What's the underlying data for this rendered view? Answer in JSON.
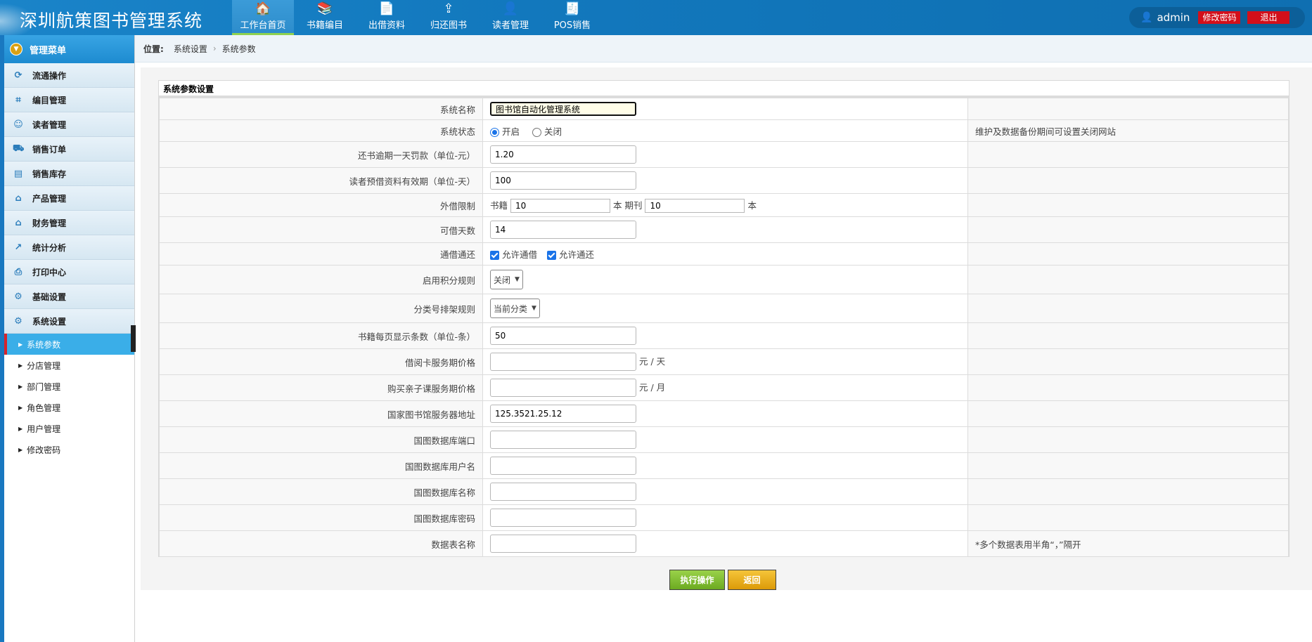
{
  "header": {
    "title": "深圳航策图书管理系统",
    "nav": [
      {
        "label": "工作台首页",
        "icon": "home-icon",
        "glyph": "🏠"
      },
      {
        "label": "书籍编目",
        "icon": "books-icon",
        "glyph": "📚"
      },
      {
        "label": "出借资料",
        "icon": "lend-doc-icon",
        "glyph": "📄"
      },
      {
        "label": "归还图书",
        "icon": "return-upload-icon",
        "glyph": "⇪"
      },
      {
        "label": "读者管理",
        "icon": "reader-icon",
        "glyph": "👤"
      },
      {
        "label": "POS销售",
        "icon": "pos-icon",
        "glyph": "🧾"
      }
    ],
    "user": "admin",
    "change_password": "修改密码",
    "logout": "退出"
  },
  "sidebar": {
    "title": "管理菜单",
    "items": [
      {
        "label": "流通操作",
        "icon": "circulation-icon",
        "glyph": "⟳"
      },
      {
        "label": "编目管理",
        "icon": "catalog-icon",
        "glyph": "⌗"
      },
      {
        "label": "读者管理",
        "icon": "reader-icon",
        "glyph": "☺"
      },
      {
        "label": "销售订单",
        "icon": "cart-icon",
        "glyph": "⛟"
      },
      {
        "label": "销售库存",
        "icon": "inventory-icon",
        "glyph": "▤"
      },
      {
        "label": "产品管理",
        "icon": "product-icon",
        "glyph": "⌂"
      },
      {
        "label": "财务管理",
        "icon": "finance-icon",
        "glyph": "⌂"
      },
      {
        "label": "统计分析",
        "icon": "chart-icon",
        "glyph": "↗"
      },
      {
        "label": "打印中心",
        "icon": "printer-icon",
        "glyph": "⎙"
      },
      {
        "label": "基础设置",
        "icon": "gear-icon",
        "glyph": "⚙"
      },
      {
        "label": "系统设置",
        "icon": "gear-icon",
        "glyph": "⚙"
      }
    ],
    "sub_items": [
      "系统参数",
      "分店管理",
      "部门管理",
      "角色管理",
      "用户管理",
      "修改密码"
    ]
  },
  "breadcrumb": {
    "label": "位置:",
    "path": [
      "系统设置",
      "系统参数"
    ]
  },
  "panel": {
    "title": "系统参数设置",
    "rows": {
      "system_name": {
        "label": "系统名称",
        "value": "图书馆自动化管理系统"
      },
      "system_status": {
        "label": "系统状态",
        "on": "开启",
        "off": "关闭",
        "tip": "维护及数据备份期间可设置关闭网站"
      },
      "overdue_fine": {
        "label": "还书逾期一天罚款（单位-元）",
        "value": "1.20"
      },
      "reserve_valid": {
        "label": "读者预借资料有效期（单位-天）",
        "value": "100"
      },
      "borrow_limit": {
        "label": "外借限制",
        "books_label": "书籍",
        "books_value": "10",
        "books_unit": "本",
        "periodicals_label": "期刊",
        "periodicals_value": "10",
        "periodicals_unit": "本"
      },
      "borrow_days": {
        "label": "可借天数",
        "value": "14"
      },
      "universal": {
        "label": "通借通还",
        "allow_borrow": "允许通借",
        "allow_return": "允许通还"
      },
      "points_rule": {
        "label": "启用积分规则",
        "selected": "关闭"
      },
      "shelving_rule": {
        "label": "分类号排架规则",
        "selected": "当前分类"
      },
      "page_size": {
        "label": "书籍每页显示条数（单位-条）",
        "value": "50"
      },
      "card_price": {
        "label": "借阅卡服务期价格",
        "value": "",
        "unit": "元 / 天"
      },
      "course_price": {
        "label": "购买亲子课服务期价格",
        "value": "",
        "unit": "元 / 月"
      },
      "nlc_server": {
        "label": "国家图书馆服务器地址",
        "value": "125.3521.25.12"
      },
      "db_port": {
        "label": "国图数据库端口",
        "value": ""
      },
      "db_user": {
        "label": "国图数据库用户名",
        "value": ""
      },
      "db_name": {
        "label": "国图数据库名称",
        "value": ""
      },
      "db_password": {
        "label": "国图数据库密码",
        "value": ""
      },
      "table_names": {
        "label": "数据表名称",
        "value": "",
        "tip": "*多个数据表用半角“，”隔开"
      }
    }
  },
  "actions": {
    "execute": "执行操作",
    "back": "返回"
  }
}
